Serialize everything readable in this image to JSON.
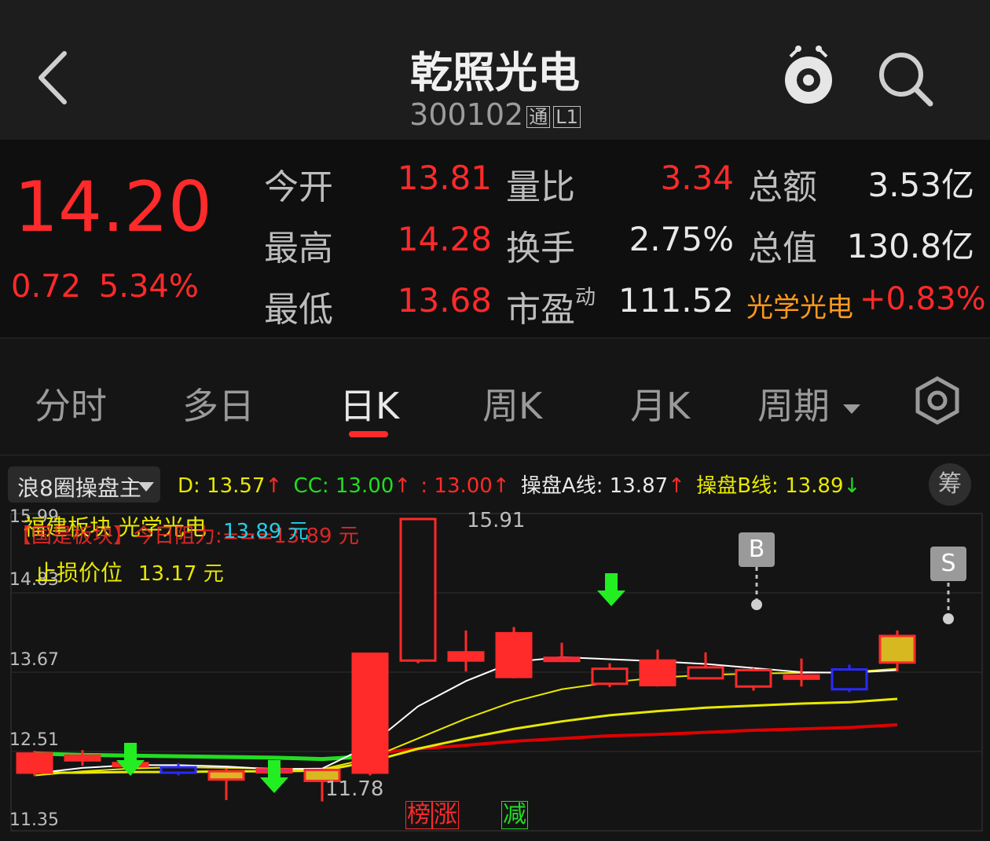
{
  "header": {
    "title": "乾照光电",
    "code": "300102",
    "badge_tong": "通",
    "badge_l1": "L1"
  },
  "quote": {
    "price": "14.20",
    "change": "0.72",
    "change_pct": "5.34%",
    "rows": [
      {
        "l1": "今开",
        "v1": "13.81",
        "l2": "量比",
        "v2": "3.34",
        "l3": "总额",
        "v3": "3.53亿"
      },
      {
        "l1": "最高",
        "v1": "14.28",
        "l2": "换手",
        "v2": "2.75%",
        "l3": "总值",
        "v3": "130.8亿"
      },
      {
        "l1": "最低",
        "v1": "13.68",
        "l2": "市盈",
        "l2_sup": "动",
        "v2": "111.52",
        "l3": "光学光电",
        "v3": "+0.83%"
      }
    ]
  },
  "tabs": [
    "分时",
    "多日",
    "日K",
    "周K",
    "月K",
    "周期"
  ],
  "active_tab": "日K",
  "indicator": {
    "name": "浪8圈操盘主",
    "d_label": "D: 13.57",
    "cc_label": "CC: 13.00",
    "c3_label": ": 13.00",
    "a_label": "操盘A线: 13.87",
    "b_label": "操盘B线: 13.89",
    "chip_btn": "筹"
  },
  "overlay": {
    "line1": "福建板块 光学光电",
    "line2": "【国是板块】今日阻力:===13.89 元",
    "resist_value": "13.89 元",
    "stop_label": "止损价位",
    "stop_value": "13.17 元"
  },
  "axis": [
    "15.99",
    "14.83",
    "13.67",
    "12.51",
    "11.35"
  ],
  "marks": {
    "high": "15.91",
    "low": "11.78",
    "b": "B",
    "s": "S",
    "tag1": "榜",
    "tag2": "涨",
    "tag3": "减"
  },
  "colors": {
    "up": "#ff2a2a",
    "down_blue": "#2a2aff",
    "ma_white": "#ffffff",
    "ma_yellow": "#e8e800",
    "ma_red": "#e00000",
    "ma_green": "#22dd22"
  },
  "chart_data": {
    "type": "candlestick",
    "ylim": [
      11.35,
      15.99
    ],
    "candles": [
      {
        "o": 12.2,
        "c": 12.48,
        "h": 12.52,
        "l": 12.15,
        "up": true
      },
      {
        "o": 12.38,
        "c": 12.45,
        "h": 12.53,
        "l": 12.3,
        "up": true
      },
      {
        "o": 12.3,
        "c": 12.34,
        "h": 12.4,
        "l": 12.26,
        "up": true
      },
      {
        "o": 12.28,
        "c": 12.2,
        "h": 12.34,
        "l": 12.16,
        "up": false,
        "blue": true
      },
      {
        "o": 12.1,
        "c": 12.22,
        "h": 12.26,
        "l": 11.8,
        "up": true,
        "gold": true
      },
      {
        "o": 12.25,
        "c": 12.21,
        "h": 12.28,
        "l": 12.02,
        "up": false,
        "purple": true
      },
      {
        "o": 12.08,
        "c": 12.24,
        "h": 12.26,
        "l": 11.78,
        "up": true,
        "gold": true
      },
      {
        "o": 12.2,
        "c": 13.94,
        "h": 13.94,
        "l": 12.16,
        "up": true
      },
      {
        "o": 13.84,
        "c": 15.91,
        "h": 15.91,
        "l": 13.8,
        "up": false,
        "hollow": true
      },
      {
        "o": 13.84,
        "c": 13.96,
        "h": 14.28,
        "l": 13.68,
        "up": true
      },
      {
        "o": 13.6,
        "c": 14.24,
        "h": 14.33,
        "l": 13.58,
        "up": true
      },
      {
        "o": 13.86,
        "c": 13.88,
        "h": 14.1,
        "l": 13.84,
        "up": true,
        "purple": true
      },
      {
        "o": 13.5,
        "c": 13.72,
        "h": 13.8,
        "l": 13.45,
        "up": false,
        "hollow": true
      },
      {
        "o": 13.48,
        "c": 13.84,
        "h": 14.0,
        "l": 13.46,
        "up": true
      },
      {
        "o": 13.58,
        "c": 13.74,
        "h": 13.96,
        "l": 13.6,
        "up": false,
        "hollow": true
      },
      {
        "o": 13.46,
        "c": 13.7,
        "h": 13.73,
        "l": 13.4,
        "up": false,
        "hollow": true
      },
      {
        "o": 13.62,
        "c": 13.6,
        "h": 13.87,
        "l": 13.46,
        "up": true
      },
      {
        "o": 13.42,
        "c": 13.71,
        "h": 13.78,
        "l": 13.38,
        "up": false,
        "blue": true
      },
      {
        "o": 13.81,
        "c": 14.2,
        "h": 14.28,
        "l": 13.68,
        "up": true,
        "gold": true
      }
    ],
    "ma_white": [
      12.19,
      12.27,
      12.31,
      12.31,
      12.29,
      12.25,
      12.26,
      12.6,
      13.17,
      13.54,
      13.82,
      13.89,
      13.86,
      13.83,
      13.79,
      13.73,
      13.67,
      13.66,
      13.7
    ],
    "ma_yellow": [
      12.16,
      12.22,
      12.26,
      12.28,
      12.27,
      12.26,
      12.25,
      12.41,
      12.7,
      12.99,
      13.24,
      13.42,
      13.52,
      13.59,
      13.63,
      13.65,
      13.66,
      13.67,
      13.72
    ],
    "ma_yellow2": [
      12.2,
      12.2,
      12.21,
      12.21,
      12.22,
      12.22,
      12.23,
      12.36,
      12.55,
      12.7,
      12.84,
      12.95,
      13.04,
      13.1,
      13.15,
      13.18,
      13.21,
      13.23,
      13.28
    ],
    "ma_red": [
      null,
      null,
      null,
      null,
      null,
      null,
      null,
      12.48,
      12.55,
      12.6,
      12.66,
      12.7,
      12.74,
      12.76,
      12.79,
      12.82,
      12.84,
      12.86,
      12.9
    ],
    "ma_green": [
      12.48,
      12.46,
      12.45,
      12.44,
      12.43,
      12.42,
      12.4,
      12.44
    ]
  }
}
